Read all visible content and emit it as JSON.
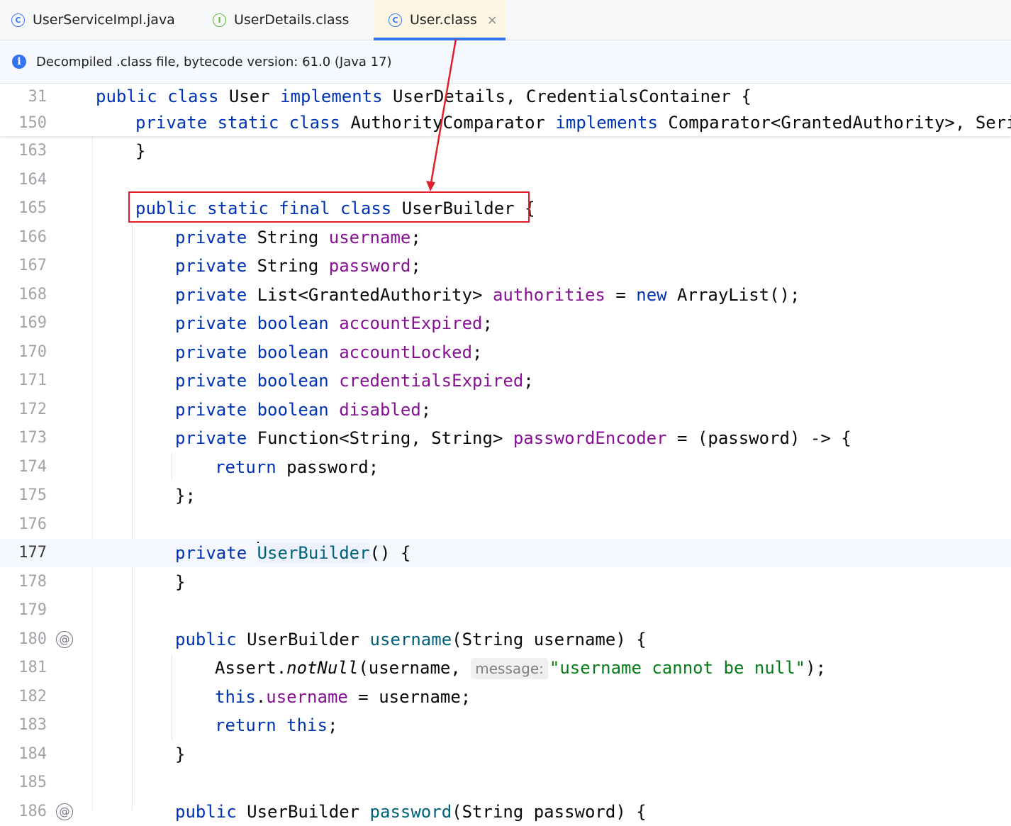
{
  "tabs": [
    {
      "label": "UserServiceImpl.java",
      "icon": "C",
      "icon_name": "class-icon"
    },
    {
      "label": "UserDetails.class",
      "icon": "I",
      "icon_name": "interface-icon"
    },
    {
      "label": "User.class",
      "icon": "C",
      "icon_name": "class-icon",
      "active": true,
      "close": "×"
    }
  ],
  "banner": {
    "icon": "i",
    "text": "Decompiled .class file, bytecode version: 61.0 (Java 17)"
  },
  "editor": {
    "current_line": "177",
    "gutter_icon": "@",
    "param_hint": "message:",
    "lines": [
      {
        "n": "31",
        "code": "public class User implements UserDetails, CredentialsContainer {"
      },
      {
        "n": "150",
        "code": "private static class AuthorityComparator implements Comparator<GrantedAuthority>, Seriali"
      },
      {
        "n": "163",
        "code": "}"
      },
      {
        "n": "164",
        "code": ""
      },
      {
        "n": "165",
        "code": "public static final class UserBuilder {"
      },
      {
        "n": "166",
        "code": "private String username;"
      },
      {
        "n": "167",
        "code": "private String password;"
      },
      {
        "n": "168",
        "code": "private List<GrantedAuthority> authorities = new ArrayList();"
      },
      {
        "n": "169",
        "code": "private boolean accountExpired;"
      },
      {
        "n": "170",
        "code": "private boolean accountLocked;"
      },
      {
        "n": "171",
        "code": "private boolean credentialsExpired;"
      },
      {
        "n": "172",
        "code": "private boolean disabled;"
      },
      {
        "n": "173",
        "code": "private Function<String, String> passwordEncoder = (password) -> {"
      },
      {
        "n": "174",
        "code": "return password;"
      },
      {
        "n": "175",
        "code": "};"
      },
      {
        "n": "176",
        "code": ""
      },
      {
        "n": "177",
        "code": "private UserBuilder() {"
      },
      {
        "n": "178",
        "code": "}"
      },
      {
        "n": "179",
        "code": ""
      },
      {
        "n": "180",
        "code": "public UserBuilder username(String username) {"
      },
      {
        "n": "181",
        "code": "Assert.notNull(username, message: \"username cannot be null\");"
      },
      {
        "n": "182",
        "code": "this.username = username;"
      },
      {
        "n": "183",
        "code": "return this;"
      },
      {
        "n": "184",
        "code": "}"
      },
      {
        "n": "185",
        "code": ""
      },
      {
        "n": "186",
        "code": "public UserBuilder password(String password) {"
      }
    ]
  },
  "annotation": {
    "color": "#e0202a"
  }
}
